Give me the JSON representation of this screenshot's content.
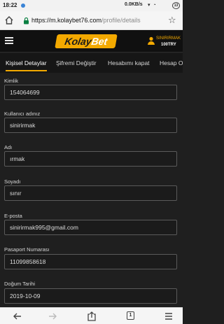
{
  "status_bar": {
    "time": "18:22",
    "network_speed": "0.0KB/s",
    "battery": "13"
  },
  "browser": {
    "url_host": "https://m.kolaybet76.com",
    "url_path": "/profile/details"
  },
  "site": {
    "logo_part1": "Kolay",
    "logo_part2": "Bet",
    "user_name": "SINIRIRMAK",
    "user_balance": "100TRY"
  },
  "tabs": [
    {
      "label": "Kişisel Detaylar",
      "active": true
    },
    {
      "label": "Şifremi Değiştir",
      "active": false
    },
    {
      "label": "Hesabımı kapat",
      "active": false
    },
    {
      "label": "Hesap Ol",
      "active": false
    }
  ],
  "fields": [
    {
      "label": "Kimlik",
      "value": "154064699"
    },
    {
      "label": "Kullanıcı adınız",
      "value": "sinirirmak"
    },
    {
      "label": "Adı",
      "value": "ırmak"
    },
    {
      "label": "Soyadı",
      "value": "sınır"
    },
    {
      "label": "E-posta",
      "value": "sinirirmak995@gmail.com"
    },
    {
      "label": "Pasaport Numarası",
      "value": "11099858618"
    },
    {
      "label": "Doğum Tarihi",
      "value": "2019-10-09"
    }
  ],
  "colors": {
    "accent": "#f3a900",
    "background": "#1f1f1f",
    "header": "#101010"
  }
}
